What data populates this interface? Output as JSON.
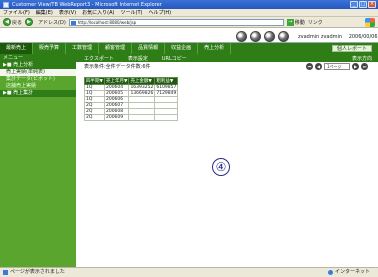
{
  "window": {
    "title": "Customer View/TB WebReport3 - Microsoft Internet Explorer"
  },
  "menu": [
    "ファイル(F)",
    "編集(E)",
    "表示(V)",
    "お気に入り(A)",
    "ツール(T)",
    "ヘルプ(H)"
  ],
  "toolbar": {
    "back": "戻る",
    "address_label": "アドレス(D)",
    "url": "http://localhost:8080/web/jsp",
    "go": "移動",
    "links": "リンク"
  },
  "user": {
    "name": "zvadmin zvadmin",
    "date": "2006/00/06"
  },
  "nav": {
    "tabs": [
      "最新売上",
      "販売予算",
      "工数管理",
      "顧客管理",
      "品質情報",
      "収益企画",
      "売上分析"
    ],
    "right": "個人レポート"
  },
  "sidebar": {
    "header": "メニュー",
    "items": [
      {
        "label": "▶■ 売上分析",
        "type": "group"
      },
      {
        "label": "売上実績(単純表)",
        "type": "child",
        "selected": true
      },
      {
        "label": "集計データ(ピボット)",
        "type": "child"
      },
      {
        "label": "店舗売上実績",
        "type": "child"
      },
      {
        "label": "▶■ 売上集計",
        "type": "group"
      }
    ]
  },
  "subtabs": [
    "エクスポート",
    "表示設定",
    "URLコピー"
  ],
  "subtabs_right": "表示方向",
  "toolrow": {
    "label": "表示条件:全件データ件数:6件",
    "page": "1ページ"
  },
  "table": {
    "headers": [
      "四半期▼",
      "売上年月▼",
      "売上金額▼",
      "粗利益▼"
    ],
    "rows": [
      [
        "1Q",
        "200604",
        "16393252",
        "6109857"
      ],
      [
        "1Q",
        "200605",
        "13669826",
        "7129849"
      ],
      [
        "1Q",
        "200606",
        "",
        ""
      ],
      [
        "2Q",
        "200607",
        "",
        ""
      ],
      [
        "2Q",
        "200608",
        "",
        ""
      ],
      [
        "2Q",
        "200609",
        "",
        ""
      ]
    ]
  },
  "marker": "④",
  "status": {
    "left": "ページが表示されました",
    "right": "インターネット"
  }
}
